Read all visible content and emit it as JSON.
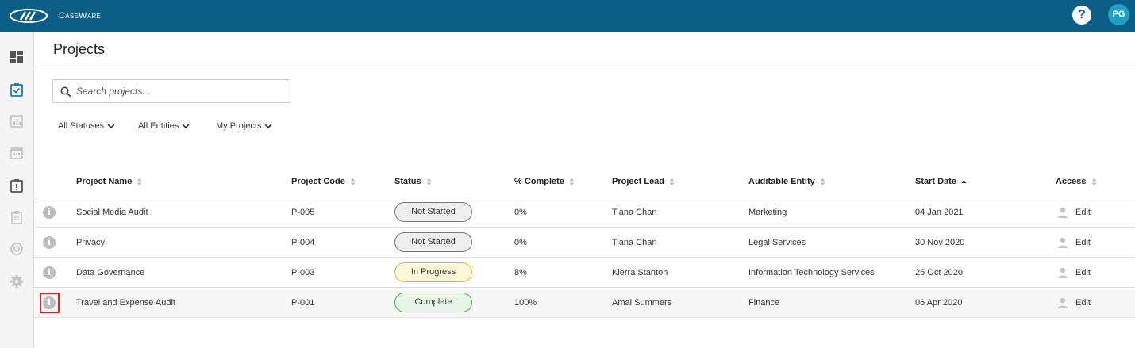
{
  "app": {
    "brand": "CaseWare",
    "help": "?",
    "user_initials": "PG",
    "brand_color": "#0b5e86"
  },
  "sidebar": {
    "items": [
      {
        "icon": "dashboard-icon"
      },
      {
        "icon": "projects-icon",
        "active": true
      },
      {
        "icon": "analytics-icon"
      },
      {
        "icon": "calendar-icon"
      },
      {
        "icon": "issues-icon"
      },
      {
        "icon": "checklist-icon"
      },
      {
        "icon": "risk-icon"
      },
      {
        "icon": "settings-icon"
      }
    ]
  },
  "page": {
    "title": "Projects"
  },
  "search": {
    "placeholder": "Search projects..."
  },
  "filters": {
    "status": "All Statuses",
    "entities": "All Entities",
    "scope": "My Projects"
  },
  "table": {
    "headers": {
      "name": "Project Name",
      "code": "Project Code",
      "status": "Status",
      "complete": "% Complete",
      "lead": "Project Lead",
      "entity": "Auditable Entity",
      "start": "Start Date",
      "access": "Access"
    },
    "sort": {
      "column": "start",
      "direction": "ascending"
    },
    "rows": [
      {
        "name": "Social Media Audit",
        "code": "P-005",
        "status": "Not Started",
        "complete": "0%",
        "lead": "Tiana Chan",
        "entity": "Marketing",
        "start": "04 Jan 2021",
        "access": "Edit"
      },
      {
        "name": "Privacy",
        "code": "P-004",
        "status": "Not Started",
        "complete": "0%",
        "lead": "Tiana Chan",
        "entity": "Legal Services",
        "start": "30 Nov 2020",
        "access": "Edit"
      },
      {
        "name": "Data Governance",
        "code": "P-003",
        "status": "In Progress",
        "complete": "8%",
        "lead": "Kierra Stanton",
        "entity": "Information Technology Services",
        "start": "26 Oct 2020",
        "access": "Edit"
      },
      {
        "name": "Travel and Expense Audit",
        "code": "P-001",
        "status": "Complete",
        "complete": "100%",
        "lead": "Amal Summers",
        "entity": "Finance",
        "start": "06 Apr 2020",
        "access": "Edit"
      }
    ]
  }
}
